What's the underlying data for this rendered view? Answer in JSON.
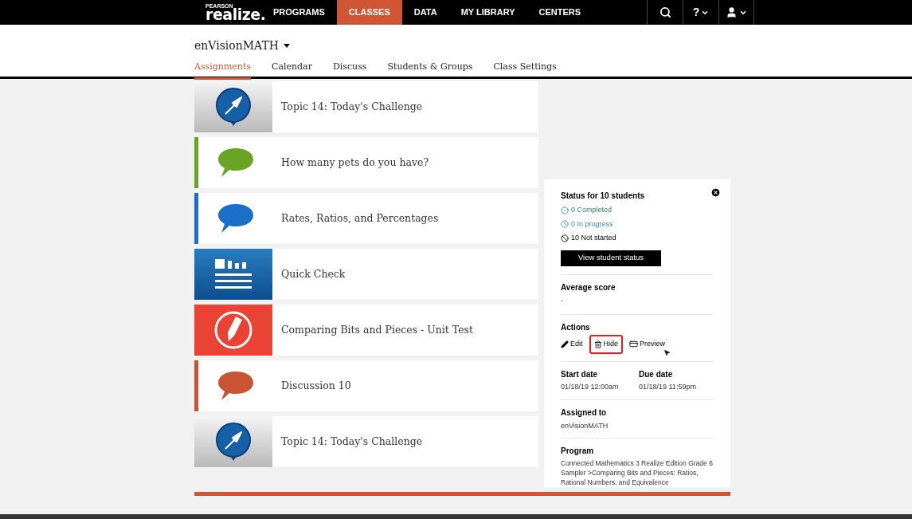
{
  "nav": {
    "logo_small": "PEARSON",
    "logo": "realize.",
    "items": [
      {
        "label": "PROGRAMS",
        "selected": false
      },
      {
        "label": "CLASSES",
        "selected": true
      },
      {
        "label": "DATA",
        "selected": false
      },
      {
        "label": "MY LIBRARY",
        "selected": false
      },
      {
        "label": "CENTERS",
        "selected": false
      }
    ],
    "help": "?"
  },
  "class_name": "enVisionMATH",
  "tabs": [
    {
      "label": "Assignments",
      "selected": true
    },
    {
      "label": "Calendar",
      "selected": false
    },
    {
      "label": "Discuss",
      "selected": false
    },
    {
      "label": "Students & Groups",
      "selected": false
    },
    {
      "label": "Class Settings",
      "selected": false
    }
  ],
  "assignments": [
    {
      "kind": "challenge",
      "title": "Topic 14: Today's Challenge"
    },
    {
      "kind": "discussion",
      "color": "#6aa424",
      "title": "How many pets do you have?"
    },
    {
      "kind": "discussion",
      "color": "#1a6fc9",
      "title": "Rates, Ratios, and Percentages"
    },
    {
      "kind": "quickcheck",
      "title": "Quick Check"
    },
    {
      "kind": "test",
      "title": "Comparing Bits and Pieces - Unit Test"
    },
    {
      "kind": "discussion",
      "color": "#c85434",
      "title": "Discussion 10"
    },
    {
      "kind": "challenge",
      "title": "Topic 14: Today's Challenge"
    }
  ],
  "details": {
    "status_title": "Status for 10 students",
    "statuses": [
      {
        "kind": "completed",
        "text": "0 Completed"
      },
      {
        "kind": "progress",
        "text": "0 In progress"
      },
      {
        "kind": "not_started",
        "text": "10 Not started"
      }
    ],
    "view_button": "View student status",
    "average_label": "Average score",
    "average_value": "-",
    "actions_label": "Actions",
    "actions": [
      {
        "kind": "edit",
        "label": "Edit",
        "highlighted": false
      },
      {
        "kind": "hide",
        "label": "Hide",
        "highlighted": true
      },
      {
        "kind": "preview",
        "label": "Preview",
        "highlighted": false
      }
    ],
    "start_label": "Start date",
    "start_value": "01/18/19 12:00am",
    "due_label": "Due date",
    "due_value": "01/18/19 11:59pm",
    "assigned_label": "Assigned to",
    "assigned_value": "enVisionMATH",
    "program_label": "Program",
    "program_value": "Connected Mathematics 3 Realize Edition Grade 6 Sampler >Comparing Bits and Pieces: Ratios, Rational Numbers, and Equivalence"
  }
}
